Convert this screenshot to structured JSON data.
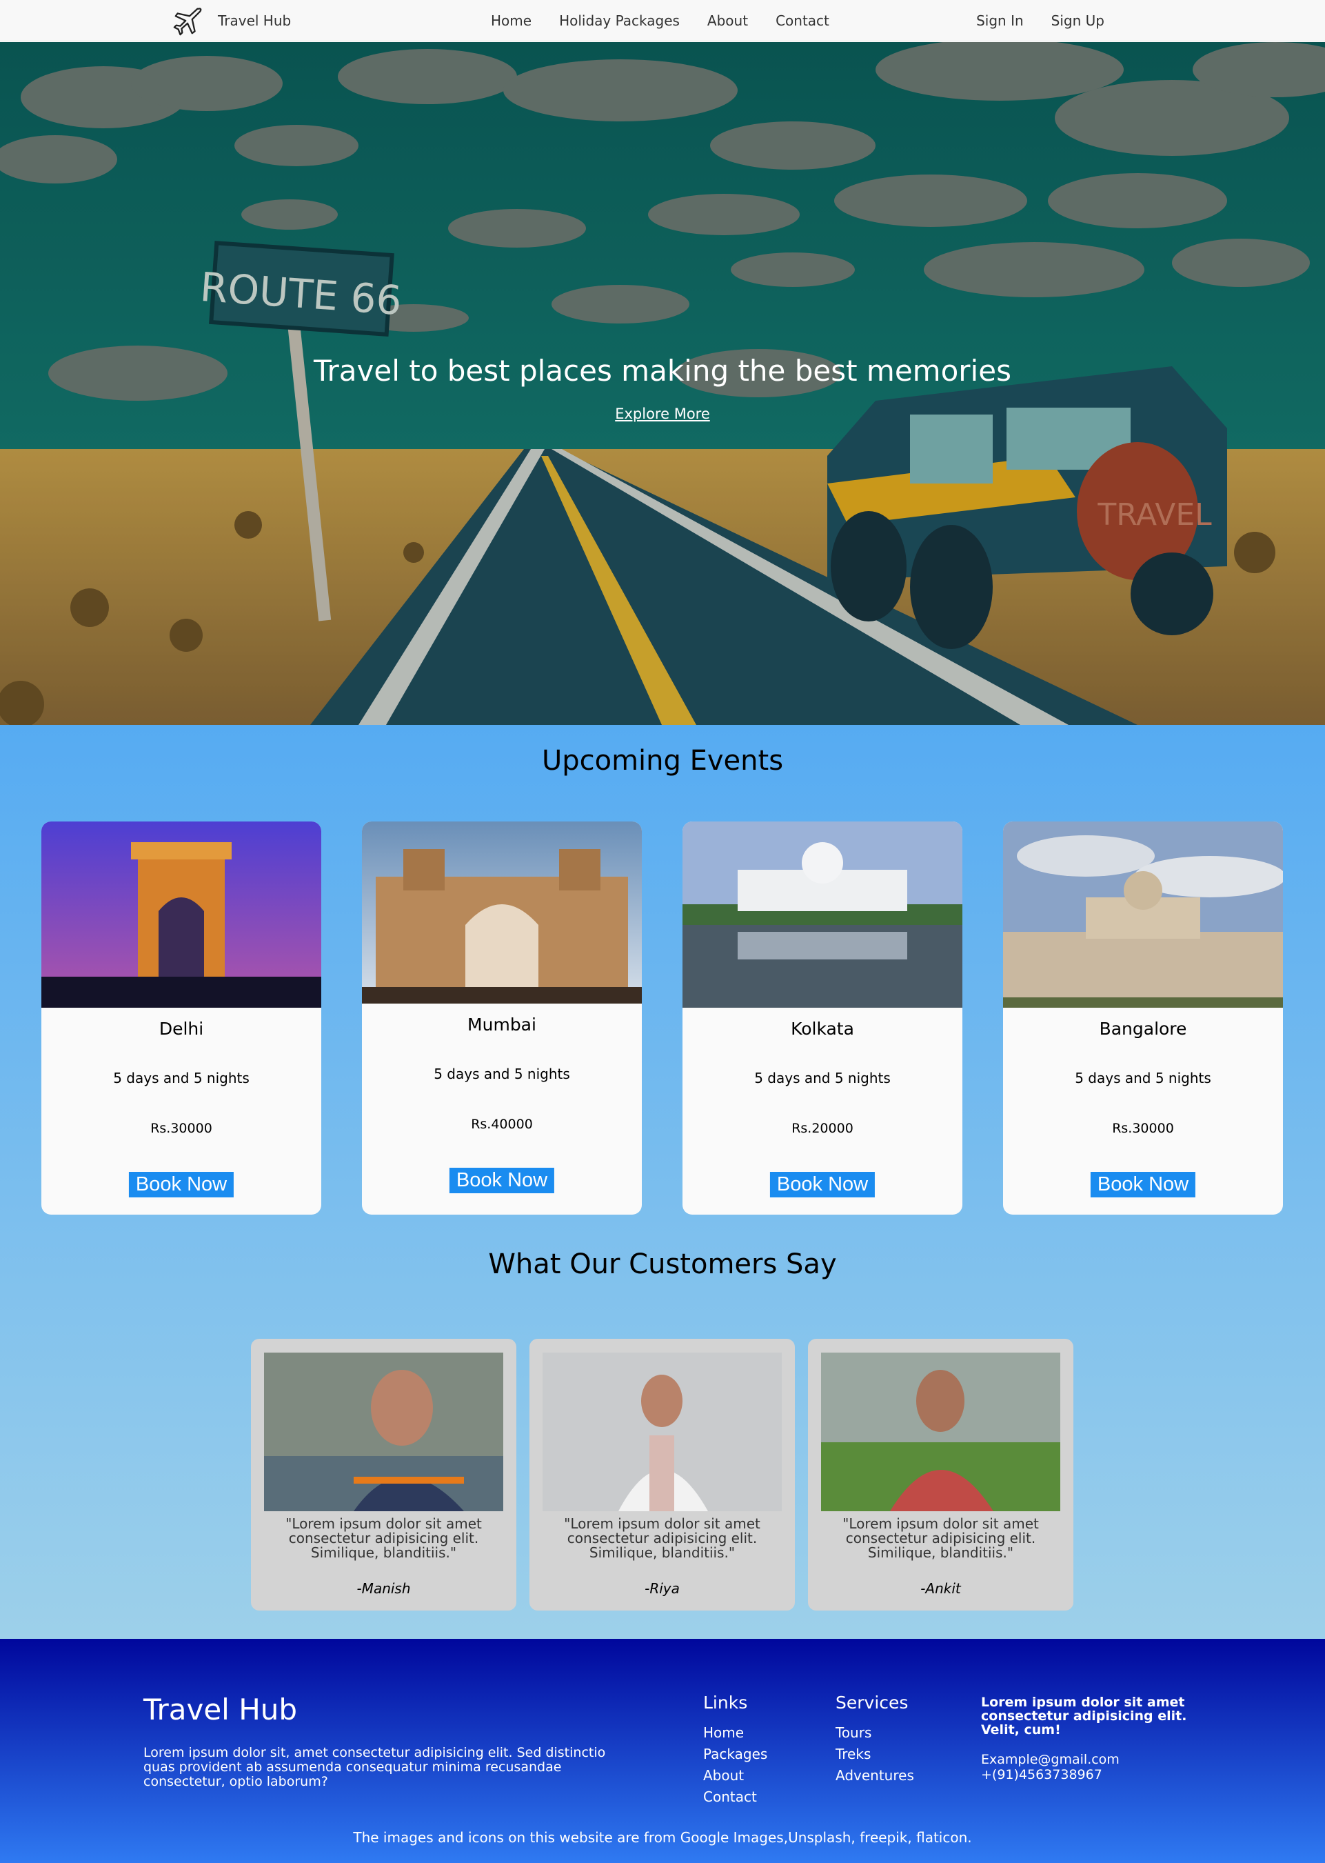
{
  "navbar": {
    "brand": "Travel Hub",
    "links": [
      "Home",
      "Holiday Packages",
      "About",
      "Contact"
    ],
    "sign_in": "Sign In",
    "sign_up": "Sign Up"
  },
  "hero": {
    "title": "Travel to best places making the best memories",
    "link": "Explore More",
    "sign_text": "ROUTE 66",
    "tire_text": "TRAVEL"
  },
  "events": {
    "title": "Upcoming Events",
    "cards": [
      {
        "city": "Delhi",
        "duration": "5 days and 5 nights",
        "price": "Rs.30000",
        "button": "Book Now"
      },
      {
        "city": "Mumbai",
        "duration": "5 days and 5 nights",
        "price": "Rs.40000",
        "button": "Book Now"
      },
      {
        "city": "Kolkata",
        "duration": "5 days and 5 nights",
        "price": "Rs.20000",
        "button": "Book Now"
      },
      {
        "city": "Bangalore",
        "duration": "5 days and 5 nights",
        "price": "Rs.30000",
        "button": "Book Now"
      }
    ]
  },
  "testimonials": {
    "title": "What Our Customers Say",
    "items": [
      {
        "quote": "\"Lorem ipsum dolor sit amet consectetur adipisicing elit. Similique, blanditiis.\"",
        "author": "-Manish"
      },
      {
        "quote": "\"Lorem ipsum dolor sit amet consectetur adipisicing elit. Similique, blanditiis.\"",
        "author": "-Riya"
      },
      {
        "quote": "\"Lorem ipsum dolor sit amet consectetur adipisicing elit. Similique, blanditiis.\"",
        "author": "-Ankit"
      }
    ]
  },
  "footer": {
    "brand": "Travel Hub",
    "description": "Lorem ipsum dolor sit, amet consectetur adipisicing elit. Sed distinctio quas provident ab assumenda consequatur minima recusandae consectetur, optio laborum?",
    "links_title": "Links",
    "links": [
      "Home",
      "Packages",
      "About",
      "Contact"
    ],
    "services_title": "Services",
    "services": [
      "Tours",
      "Treks",
      "Adventures"
    ],
    "contact_text": "Lorem ipsum dolor sit amet consectetur adipisicing elit. Velit, cum!",
    "email": "Example@gmail.com",
    "phone": "+(91)4563738967",
    "credit": "The images and icons on this website are from Google Images,Unsplash, freepik, flaticon."
  }
}
